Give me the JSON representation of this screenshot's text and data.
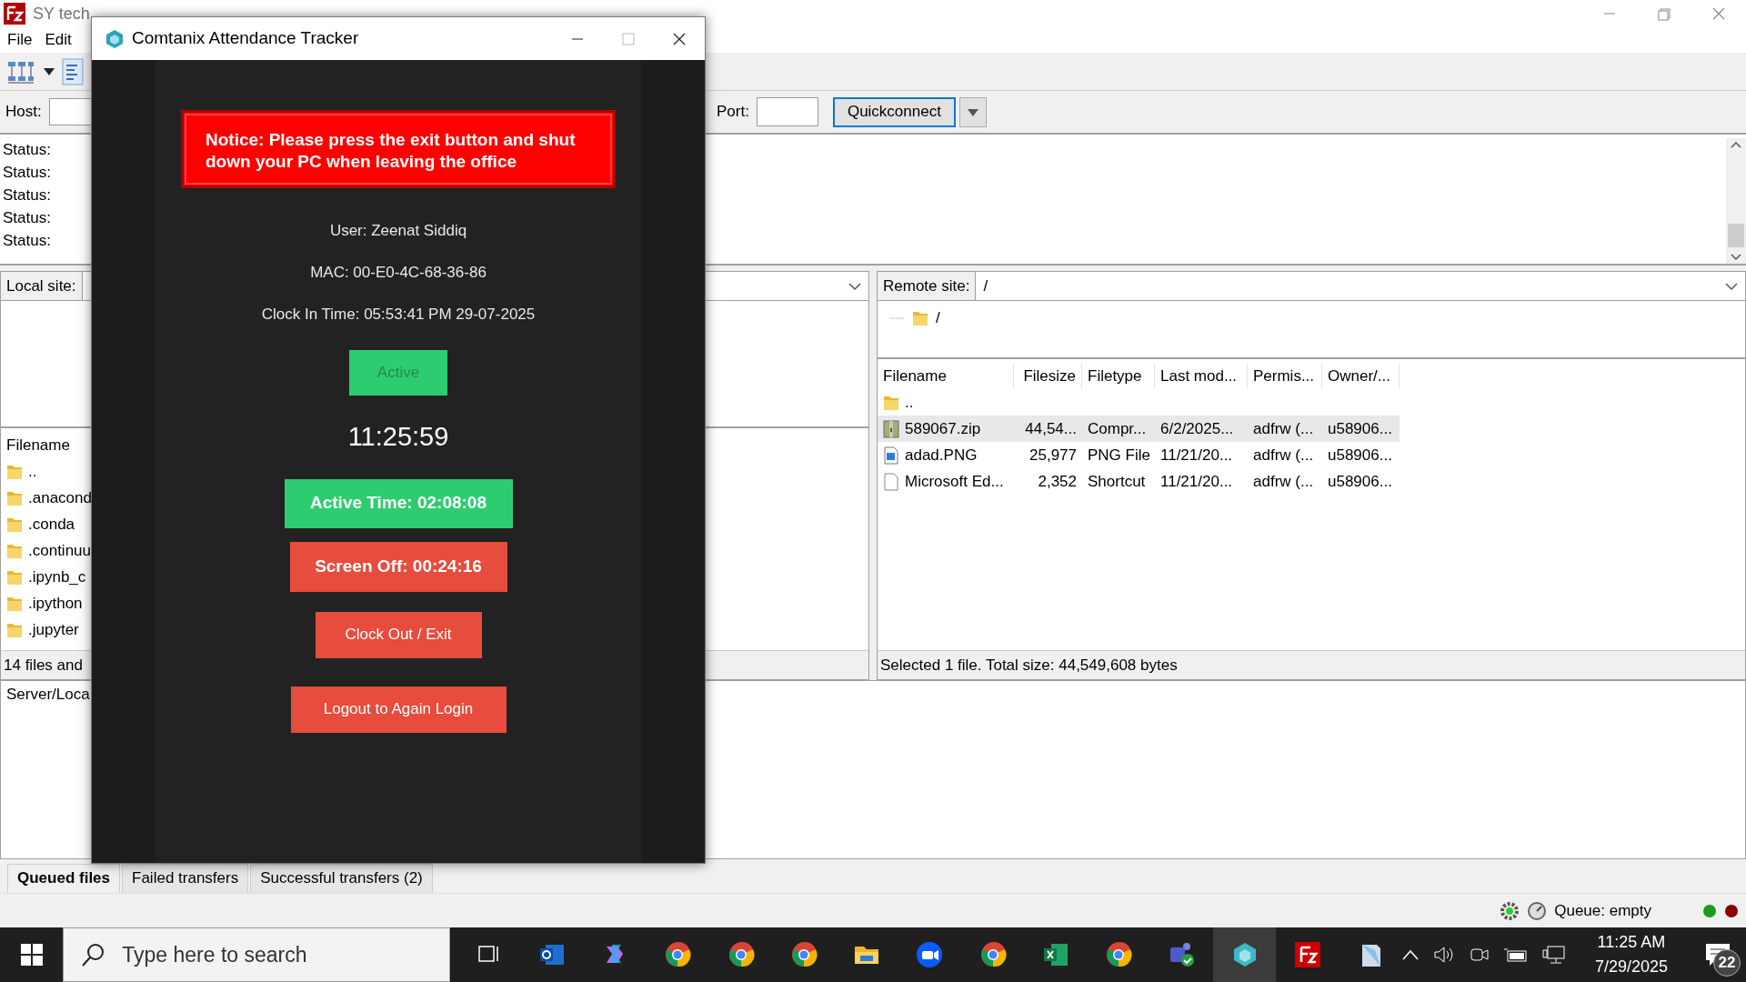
{
  "filezilla": {
    "title": "SY tech",
    "menu": [
      "File",
      "Edit"
    ],
    "quickconnect": {
      "host_label": "Host:",
      "port_label": "Port:",
      "button": "Quickconnect"
    },
    "log": [
      "Status:",
      "Status:",
      "Status:",
      "Status:",
      "Status:"
    ],
    "local": {
      "site_label": "Local site:",
      "header": "Filename",
      "files": [
        {
          "name": ".."
        },
        {
          "name": ".anacond"
        },
        {
          "name": ".conda"
        },
        {
          "name": ".continuu"
        },
        {
          "name": ".ipynb_c"
        },
        {
          "name": ".ipython"
        },
        {
          "name": ".jupyter"
        }
      ],
      "status": "14 files and"
    },
    "remote": {
      "site_label": "Remote site:",
      "path": "/",
      "tree": [
        {
          "name": "/"
        }
      ],
      "columns": [
        "Filename",
        "Filesize",
        "Filetype",
        "Last mod...",
        "Permis...",
        "Owner/..."
      ],
      "rows": [
        {
          "kind": "folder",
          "selected": false,
          "cells": [
            "..",
            "",
            "",
            "",
            "",
            ""
          ]
        },
        {
          "kind": "zip",
          "selected": true,
          "cells": [
            "589067.zip",
            "44,54...",
            "Compr...",
            "6/2/2025...",
            "adfrw (...",
            "u58906..."
          ]
        },
        {
          "kind": "image",
          "selected": false,
          "cells": [
            "adad.PNG",
            "25,977",
            "PNG File",
            "11/21/20...",
            "adfrw (...",
            "u58906..."
          ]
        },
        {
          "kind": "file",
          "selected": false,
          "cells": [
            "Microsoft Ed...",
            "2,352",
            "Shortcut",
            "11/21/20...",
            "adfrw (...",
            "u58906..."
          ]
        }
      ],
      "status": "Selected 1 file. Total size: 44,549,608 bytes"
    },
    "queue": {
      "header": "Server/Loca",
      "tabs": [
        {
          "label": "Queued files",
          "selected": true
        },
        {
          "label": "Failed transfers",
          "selected": false
        },
        {
          "label": "Successful transfers (2)",
          "selected": false
        }
      ]
    },
    "status_bar": {
      "queue": "Queue: empty"
    }
  },
  "dialog": {
    "title": "Comtanix Attendance Tracker",
    "notice": "Notice: Please press the exit button and shut down your PC when leaving the office",
    "user": "User: Zeenat Siddiq",
    "mac": "MAC: 00-E0-4C-68-36-86",
    "clock_in": "Clock In Time: 05:53:41 PM 29-07-2025",
    "state": "Active",
    "clock": "11:25:59",
    "active_time": "Active Time: 02:08:08",
    "screen_off": "Screen Off: 00:24:16",
    "buttons": [
      "Clock Out / Exit",
      "Logout to Again Login"
    ]
  },
  "taskbar": {
    "search_placeholder": "Type here to search",
    "time": "11:25 AM",
    "date": "7/29/2025",
    "notifications": "22"
  }
}
